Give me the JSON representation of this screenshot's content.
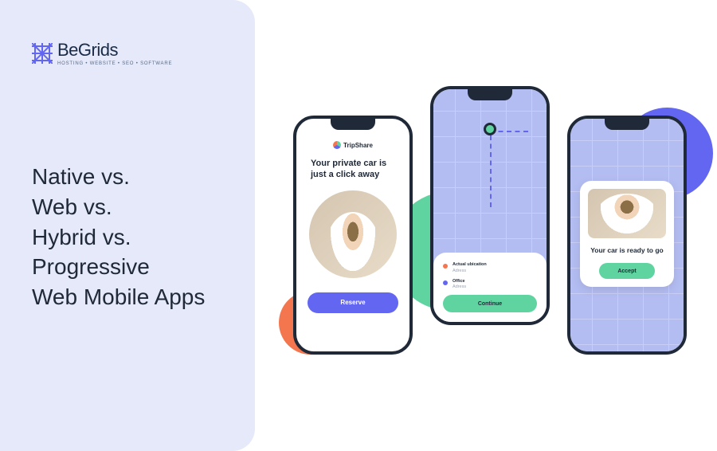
{
  "logo": {
    "name": "BeGrids",
    "tagline": "HOSTING • WEBSITE • SEO • SOFTWARE"
  },
  "headline": "Native vs.\nWeb vs.\nHybrid vs.\nProgressive\nWeb Mobile Apps",
  "phones": {
    "app_name": "TripShare",
    "phone1": {
      "tagline": "Your private car is just a click away",
      "button": "Reserve"
    },
    "phone2": {
      "loc1_label": "Actual ubication",
      "loc1_sub": "Adress",
      "loc2_label": "Office",
      "loc2_sub": "Adress",
      "button": "Continue"
    },
    "phone3": {
      "title": "Your car is ready to go",
      "button": "Accept"
    }
  },
  "colors": {
    "orange": "#f4764e",
    "green": "#5fd4a0",
    "purple": "#6366f1",
    "panel": "#e5e9f9",
    "dark": "#1f2937"
  }
}
